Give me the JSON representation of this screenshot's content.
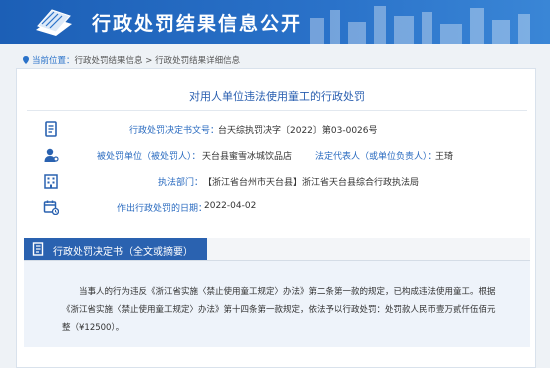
{
  "header": {
    "title": "行政处罚结果信息公开"
  },
  "breadcrumb": {
    "prefix": "当前位置：",
    "level1": "行政处罚结果信息",
    "sep": " > ",
    "level2": "行政处罚结果详细信息"
  },
  "document": {
    "title": "对用人单位违法使用童工的行政处罚",
    "decision_no_label": "行政处罚决定书文号：",
    "decision_no": "台天综执罚决字〔2022〕第03-0026号",
    "party_label": "被处罚单位（被处罚人）：",
    "party": "天台县蜜雪冰城饮品店",
    "legal_rep_label": "法定代表人（或单位负责人）：",
    "legal_rep": "王琦",
    "dept_label": "执法部门：",
    "dept": "【浙江省台州市天台县】浙江省天台县综合行政执法局",
    "date_label": "作出行政处罚的日期：",
    "date": "2022-04-02"
  },
  "section": {
    "title": "行政处罚决定书（全文或摘要）",
    "body": "当事人的行为违反《浙江省实施〈禁止使用童工规定〉办法》第二条第一款的规定，已构成违法使用童工。根据《浙江省实施〈禁止使用童工规定〉办法》第十四条第一款规定，依法予以行政处罚：处罚款人民币壹万贰仟伍佰元整（¥12500）。"
  },
  "icons": [
    "document-icon",
    "person-icon",
    "building-icon",
    "calendar-icon",
    "notebook-icon",
    "location-pin-icon",
    "logo-book-icon"
  ],
  "colors": {
    "banner": "#2a72c9",
    "label": "#2a6bc0",
    "tab": "#2a62b0"
  }
}
